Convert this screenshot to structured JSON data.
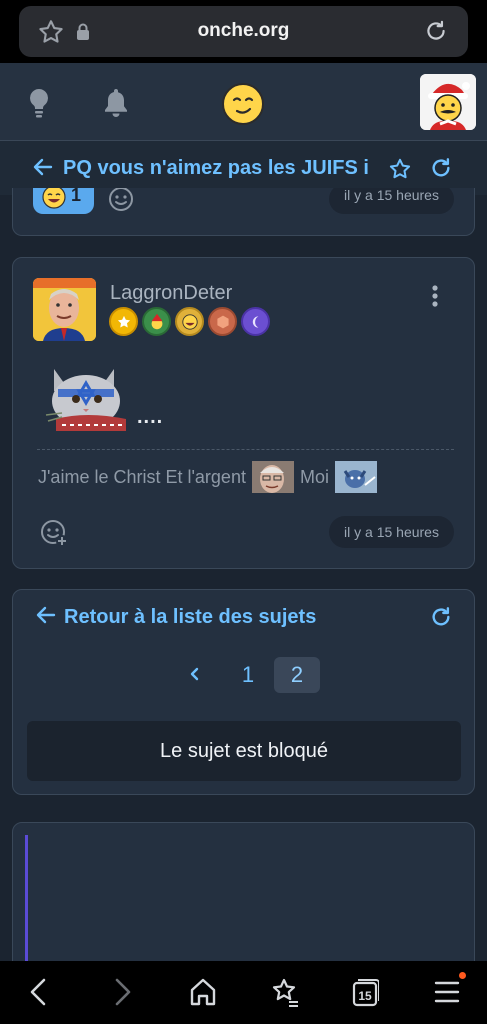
{
  "browser": {
    "url": "onche.org",
    "tab_count": "15"
  },
  "topic": {
    "title": "PQ vous n'aimez pas les JUIFS i"
  },
  "previous_post": {
    "reaction_count": "1",
    "time": "il y a 15 heures"
  },
  "post": {
    "username": "LaggronDeter",
    "badges": [
      "star-badge",
      "elf-badge",
      "laugh-badge",
      "bronze-badge",
      "moon-badge"
    ],
    "image_trailing_text": "....",
    "signature": {
      "part1": "J'aime le Christ Et l'argent",
      "part2": "Moi"
    },
    "time": "il y a 15 heures"
  },
  "navigation": {
    "back_label": "Retour à la liste des sujets",
    "pages": [
      "1",
      "2"
    ],
    "current_page": "2",
    "locked_message": "Le sujet est bloqué"
  },
  "colors": {
    "accent": "#6ec0ff",
    "background": "#1b2430",
    "card": "#243040",
    "notification_dot": "#ff5a1f"
  }
}
